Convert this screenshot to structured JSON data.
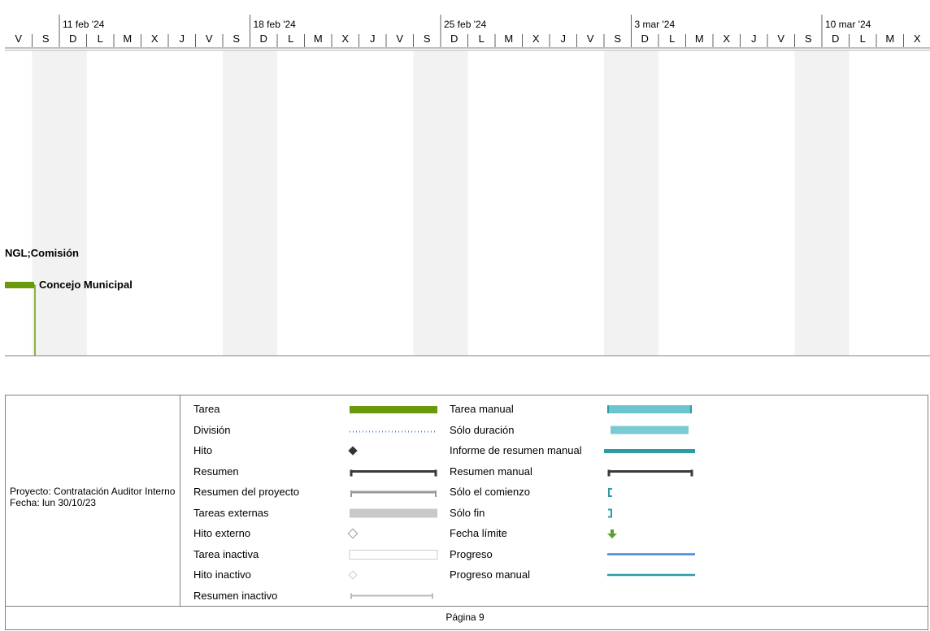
{
  "timescale": {
    "weeks": [
      "11 feb '24",
      "18 feb '24",
      "25 feb '24",
      "3 mar '24",
      "10 mar '24"
    ],
    "days": [
      "V",
      "S",
      "D",
      "L",
      "M",
      "X",
      "J",
      "V",
      "S",
      "D",
      "L",
      "M",
      "X",
      "J",
      "V",
      "S",
      "D",
      "L",
      "M",
      "X",
      "J",
      "V",
      "S",
      "D",
      "L",
      "M",
      "X",
      "J",
      "V",
      "S",
      "D",
      "L",
      "M",
      "X"
    ],
    "weekend_shading": "#f2f2f2"
  },
  "gantt": {
    "labels": {
      "resources_1": "NGL;Comisión",
      "resources_2": "Concejo Municipal"
    },
    "colors": {
      "task": "#6a9a0b",
      "grid": "#808080"
    }
  },
  "legend": {
    "project_line": "Proyecto: Contratación Auditor Interno",
    "date_line": "Fecha: lun 30/10/23",
    "left_items": [
      {
        "label": "Tarea",
        "symbol": "task"
      },
      {
        "label": "División",
        "symbol": "split"
      },
      {
        "label": "Hito",
        "symbol": "milestone"
      },
      {
        "label": "Resumen",
        "symbol": "summary"
      },
      {
        "label": "Resumen del proyecto",
        "symbol": "project-summary"
      },
      {
        "label": "Tareas externas",
        "symbol": "external-tasks"
      },
      {
        "label": "Hito externo",
        "symbol": "external-milestone"
      },
      {
        "label": "Tarea inactiva",
        "symbol": "inactive-task"
      },
      {
        "label": "Hito inactivo",
        "symbol": "inactive-milestone"
      },
      {
        "label": "Resumen inactivo",
        "symbol": "inactive-summary"
      }
    ],
    "right_items": [
      {
        "label": "Tarea manual",
        "symbol": "manual-task"
      },
      {
        "label": "Sólo duración",
        "symbol": "duration-only"
      },
      {
        "label": "Informe de resumen manual",
        "symbol": "manual-summary-rollup"
      },
      {
        "label": "Resumen manual",
        "symbol": "manual-summary"
      },
      {
        "label": "Sólo el comienzo",
        "symbol": "start-only"
      },
      {
        "label": "Sólo fin",
        "symbol": "finish-only"
      },
      {
        "label": "Fecha límite",
        "symbol": "deadline"
      },
      {
        "label": "Progreso",
        "symbol": "progress"
      },
      {
        "label": "Progreso manual",
        "symbol": "manual-progress"
      }
    ],
    "colors": {
      "task": "#6a9a0b",
      "manual": "#6cc4cf",
      "manual_dark": "#2d9ba8",
      "progress": "#4a86d8",
      "summary": "#3a3a3a",
      "external": "#c8c8c8",
      "deadline": "#5aa02c"
    }
  },
  "footer": {
    "page": "Página 9"
  }
}
